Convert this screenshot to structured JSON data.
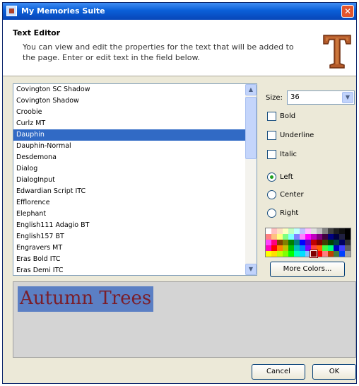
{
  "window": {
    "title": "My Memories Suite",
    "close_glyph": "✕"
  },
  "header": {
    "title": "Text Editor",
    "description": "You can view and edit the properties for the text that will be added to the page. Enter or edit text in the field below.",
    "icon": "serif-T-icon",
    "icon_letter": "T"
  },
  "font_list": {
    "items": [
      "Covington SC Shadow",
      "Covington Shadow",
      "Croobie",
      "Curlz MT",
      "Dauphin",
      "Dauphin-Normal",
      "Desdemona",
      "Dialog",
      "DialogInput",
      "Edwardian Script ITC",
      "Efflorence",
      "Elephant",
      "English111 Adagio BT",
      "English157 BT",
      "Engravers MT",
      "Eras Bold ITC",
      "Eras Demi ITC"
    ],
    "selected": "Dauphin"
  },
  "size": {
    "label": "Size:",
    "value": "36"
  },
  "styles": {
    "bold": "Bold",
    "underline": "Underline",
    "italic": "Italic"
  },
  "alignment": {
    "left": "Left",
    "center": "Center",
    "right": "Right",
    "selected": "Left"
  },
  "palette": {
    "colors": [
      "#ffffff",
      "#ffc0c0",
      "#ffe0c0",
      "#ffffc0",
      "#c0ffc0",
      "#c0ffff",
      "#c0c0ff",
      "#ffc0ff",
      "#e0e0e0",
      "#c0c0c0",
      "#808080",
      "#404040",
      "#202020",
      "#101010",
      "#000000",
      "#ff8080",
      "#ffc080",
      "#ffff80",
      "#80ff80",
      "#80ffff",
      "#8080ff",
      "#ff80ff",
      "#ff00ff",
      "#c000c0",
      "#800080",
      "#400040",
      "#000080",
      "#000040",
      "#202040",
      "#000000",
      "#ff40ff",
      "#ff0080",
      "#804000",
      "#808000",
      "#008000",
      "#008080",
      "#0000ff",
      "#6000c0",
      "#c00000",
      "#800000",
      "#404000",
      "#004000",
      "#004040",
      "#000060",
      "#303030",
      "#ff00c0",
      "#ff0000",
      "#ff8000",
      "#c0c000",
      "#00c000",
      "#00c0c0",
      "#0080ff",
      "#8000ff",
      "#ff4040",
      "#ff6000",
      "#40ff40",
      "#00ff80",
      "#0000c0",
      "#4040ff",
      "#606060",
      "#ffff00",
      "#ffe000",
      "#c0ff00",
      "#80ff00",
      "#00ff00",
      "#00ffc0",
      "#00e0ff",
      "#80c0ff",
      "#800000",
      "#ff0000",
      "#ff8080",
      "#c04000",
      "#408040",
      "#0040ff",
      "#a0a0a0"
    ],
    "selected_index": 68
  },
  "buttons": {
    "more_colors": "More Colors...",
    "cancel": "Cancel",
    "ok": "OK"
  },
  "preview": {
    "text": "Autumn Trees",
    "text_color": "#7a1e2a",
    "highlight": "#5b7fc4"
  }
}
